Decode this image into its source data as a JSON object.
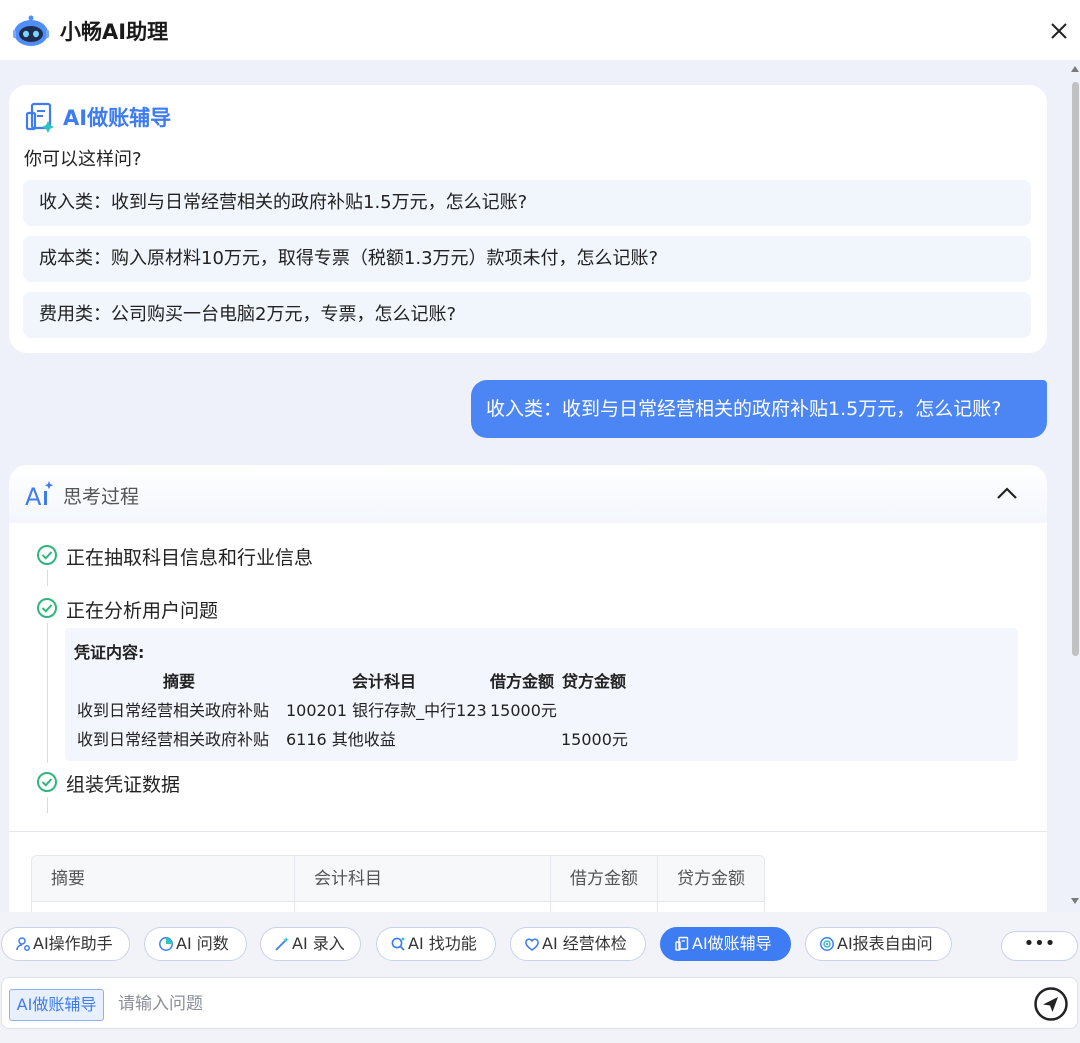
{
  "header": {
    "title": "小畅AI助理"
  },
  "suggestions": {
    "title": "AI做账辅导",
    "subtitle": "你可以这样问?",
    "items": [
      "收入类：收到与日常经营相关的政府补贴1.5万元，怎么记账?",
      "成本类：购入原材料10万元，取得专票（税额1.3万元）款项未付，怎么记账?",
      "费用类：公司购买一台电脑2万元，专票，怎么记账?"
    ]
  },
  "user_message": "收入类：收到与日常经营相关的政府补贴1.5万元，怎么记账?",
  "thinking": {
    "title": "思考过程",
    "steps": [
      "正在抽取科目信息和行业信息",
      "正在分析用户问题",
      "组装凭证数据"
    ],
    "voucher": {
      "label": "凭证内容:",
      "headers": [
        "摘要",
        "会计科目",
        "借方金额",
        "贷方金额"
      ],
      "rows": [
        [
          "收到日常经营相关政府补贴",
          "100201 银行存款_中行123",
          "15000元",
          ""
        ],
        [
          "收到日常经营相关政府补贴",
          "6116 其他收益",
          "",
          "15000元"
        ]
      ]
    }
  },
  "result_table": {
    "headers": [
      "摘要",
      "会计科目",
      "借方金额",
      "贷方金额"
    ]
  },
  "chips": [
    {
      "label": "AI操作助手",
      "icon": "user-cog-icon",
      "active": false
    },
    {
      "label": "AI 问数",
      "icon": "chart-circle-icon",
      "active": false
    },
    {
      "label": "AI 录入",
      "icon": "magic-pen-icon",
      "active": false
    },
    {
      "label": "AI 找功能",
      "icon": "search-spark-icon",
      "active": false
    },
    {
      "label": "AI 经营体检",
      "icon": "heart-icon",
      "active": false
    },
    {
      "label": "AI做账辅导",
      "icon": "ledger-icon",
      "active": true
    },
    {
      "label": "AI报表自由问",
      "icon": "target-icon",
      "active": false
    }
  ],
  "more_label": "•••",
  "input": {
    "mode_tag": "AI做账辅导",
    "placeholder": "请输入问题",
    "value": ""
  },
  "colors": {
    "accent": "#3e7cf4",
    "user_bubble": "#4c86f5",
    "success": "#2fb67c",
    "background": "#eef1f9"
  }
}
